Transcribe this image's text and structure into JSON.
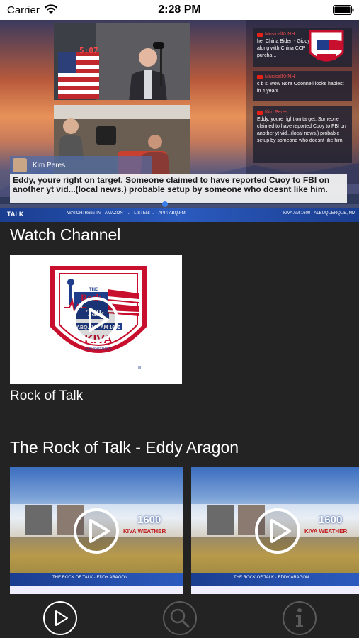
{
  "status_bar": {
    "carrier": "Carrier",
    "time": "2:28 PM"
  },
  "player": {
    "clock": "5:07",
    "chat": [
      {
        "user": "MusicalKnNH",
        "text": "her China Biden - Giddy along with China CCP purcha..."
      },
      {
        "user": "MusicalKnNH",
        "text": "c b s. wow Nora Odonnell looks hapiest in 4 years"
      },
      {
        "user": "Kim Peres",
        "text": "Eddy, youre right on target. Someone claimed to have reported Cuoy to FBI on another yt vid...(local news.) probable setup by someone who doesnt like him."
      }
    ],
    "caption_user": "Kim Peres",
    "caption_text": "Eddy, youre right on target. Someone claimed to have reported Cuoy to FBI on another yt vid...(local news.) probable setup by someone who doesnt like him.",
    "ticker_left": "TALK",
    "ticker_mid": "WATCH: Roku TV · AMAZON · ... · LISTEN: ... · APP: ABQ.FM",
    "ticker_right": "KIVA AM 1600 · ALBUQUERQUE, NM",
    "brand_color": "#2b5bbf"
  },
  "watch_section": {
    "title": "Watch Channel",
    "channel": {
      "name": "Rock of Talk",
      "logo": {
        "top": "THE",
        "rock": "Rock",
        "of": "of",
        "talk": "Talk",
        "freq": "ABQ.FM · AM 1600",
        "call": "KIVA",
        "city": "ALBUQUERQUE",
        "tm": "TM"
      }
    }
  },
  "videos_section": {
    "title": "The Rock of Talk - Eddy Aragon",
    "videos": [
      {
        "number": "1600",
        "weather": "KIVA WEATHER",
        "band": "THE ROCK OF TALK · EDDY ARAGON"
      },
      {
        "number": "1600",
        "weather": "KIVA WEATHER",
        "band": "THE ROCK OF TALK · EDDY ARAGON"
      }
    ]
  },
  "tabs": [
    {
      "icon": "play-icon",
      "active": true
    },
    {
      "icon": "search-icon",
      "active": false
    },
    {
      "icon": "info-icon",
      "active": false
    }
  ]
}
